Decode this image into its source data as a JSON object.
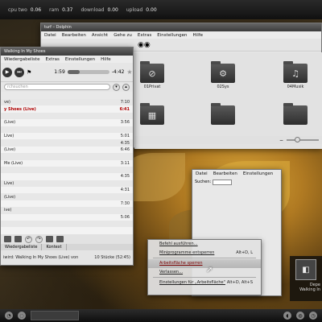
{
  "top_panel": {
    "cpu_label": "cpu two",
    "cpu_value": "0.06",
    "ram_label": "ram",
    "ram_value": "0.37",
    "download_label": "download",
    "download_value": "0.00",
    "upload_label": "upload",
    "upload_value": "0.00"
  },
  "dolphin": {
    "title": "turf – Dolphin",
    "menu": [
      "Datei",
      "Bearbeiten",
      "Ansicht",
      "Gehe zu",
      "Extras",
      "Einstellungen",
      "Hilfe"
    ],
    "folders": [
      "01Privat",
      "02Sys",
      "04Musik",
      "",
      "",
      ""
    ]
  },
  "amarok": {
    "title": "Walking In My Shoes",
    "menu": [
      "Wiedergabeliste",
      "Extras",
      "Einstellungen",
      "Hilfe"
    ],
    "elapsed": "1:59",
    "remaining": "-4:42",
    "progress": 0.3,
    "search_placeholder": "rchsuchen",
    "tracks": [
      {
        "title": "ve)",
        "time": "7:10"
      },
      {
        "title": "y Shoes (Live)",
        "time": "6:41",
        "playing": true
      },
      {
        "title": "",
        "time": ""
      },
      {
        "title": "(Live)",
        "time": "3:56"
      },
      {
        "title": "",
        "time": ""
      },
      {
        "title": "Live)",
        "time": "5:01"
      },
      {
        "title": "",
        "time": "4:35"
      },
      {
        "title": "(Live)",
        "time": "6:46"
      },
      {
        "title": "",
        "time": ""
      },
      {
        "title": "Me (Live)",
        "time": "3:11"
      },
      {
        "title": "",
        "time": ""
      },
      {
        "title": "",
        "time": "4:35"
      },
      {
        "title": "Live)",
        "time": ""
      },
      {
        "title": "",
        "time": "4:31"
      },
      {
        "title": "(Live)",
        "time": ""
      },
      {
        "title": "",
        "time": "7:30"
      },
      {
        "title": "ive)",
        "time": ""
      },
      {
        "title": "",
        "time": "5:06"
      },
      {
        "title": "",
        "time": ""
      },
      {
        "title": "",
        "time": ""
      }
    ],
    "tabs": [
      "Wiedergabeliste",
      "Kontext"
    ],
    "status_text": "iwird: Walking In My Shoes (Live) von",
    "status_count": "10 Stücke (52:45)"
  },
  "mini_window": {
    "menu": [
      "Datei",
      "Bearbeiten",
      "Einstellungen"
    ],
    "search_label": "Suchen:"
  },
  "context_menu": {
    "items": [
      {
        "label": "Befehl ausführen…",
        "shortcut": ""
      },
      {
        "label": "Miniprogramme entsperren",
        "shortcut": "Alt+D, L"
      },
      {
        "label": "Arbeitsfläche sperren",
        "shortcut": "",
        "active": true
      },
      {
        "label": "Verlassen…",
        "shortcut": ""
      },
      {
        "label": "Einstellungen für „Arbeitsfläche\"",
        "shortcut": "Alt+D, Alt+S"
      }
    ]
  },
  "now_playing": {
    "line1": "Depe",
    "line2": "Walking In"
  },
  "icons": {
    "play": "play-icon",
    "next": "next-icon",
    "star": "star-icon"
  }
}
